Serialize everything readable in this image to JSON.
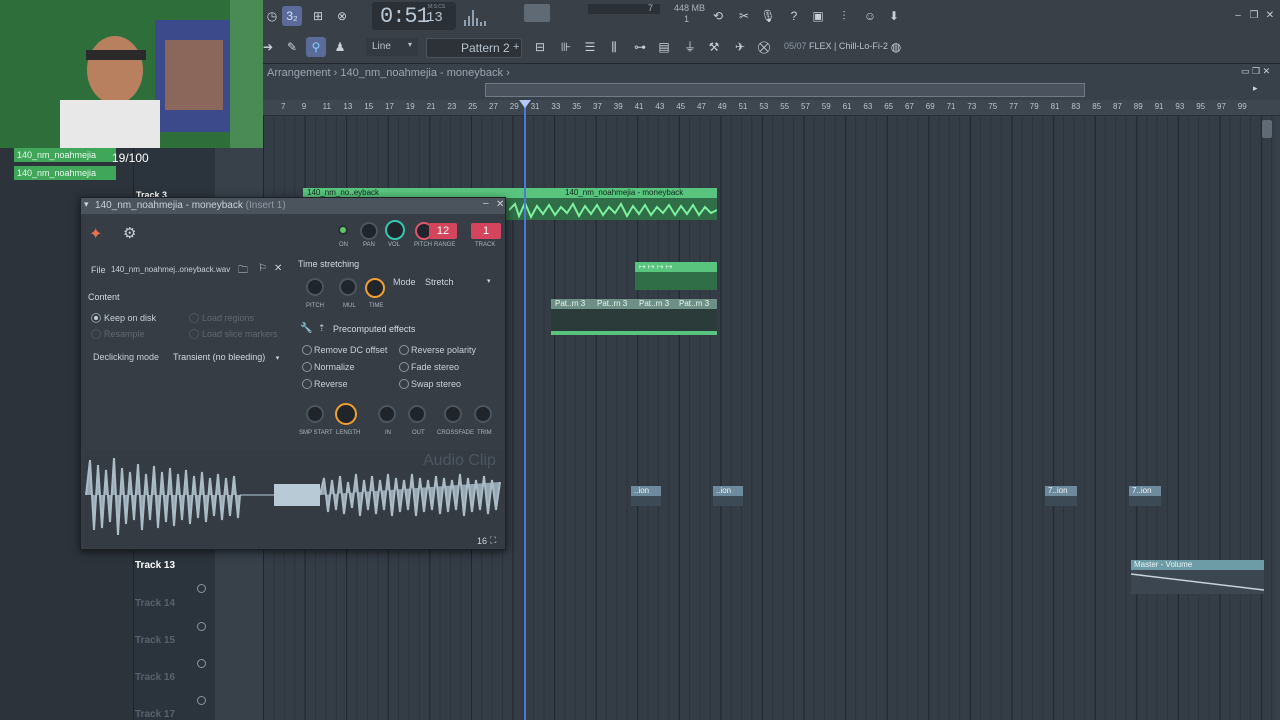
{
  "toolbar": {
    "time_main": "0:51",
    "time_sub": "13",
    "time_unit": "M:S:CS",
    "cpu_value": "7",
    "memory": "448 MB",
    "voices": "1",
    "snap_label": "Line",
    "pattern_label": "Pattern 2",
    "browser_status": "05/07",
    "browser_label": "FLEX | Chill-Lo-Fi-2"
  },
  "playlist": {
    "breadcrumb": "Arrangement › 140_nm_noahmejia - moneyback ›",
    "ruler": [
      "7",
      "9",
      "11",
      "13",
      "15",
      "17",
      "19",
      "21",
      "23",
      "25",
      "27",
      "29",
      "31",
      "33",
      "35",
      "37",
      "39",
      "41",
      "43",
      "45",
      "47",
      "49",
      "51",
      "53",
      "55",
      "57",
      "59",
      "61",
      "63",
      "65",
      "67",
      "69",
      "71",
      "73",
      "75",
      "77",
      "79",
      "81",
      "83",
      "85",
      "87",
      "89",
      "91",
      "93",
      "95",
      "97",
      "99"
    ],
    "audio_clip_label_1": "140_nm_no..eyback",
    "audio_clip_label_2": "140_nm_noahmejia - moneyback",
    "pattern_clip_label": "Pat..rn 3",
    "automation_label_1": "..ion",
    "automation_label_2": "7..ion",
    "master_volume_label": "Master - Volume",
    "track3_label": "Track 3",
    "track13_label": "Track 13",
    "ghost_tracks": [
      "Track 14",
      "Track 15",
      "Track 16",
      "Track 17"
    ]
  },
  "left": {
    "items": [
      "140_nm_noahmejia",
      "140_nm_noahmejia"
    ],
    "counter": "19/100"
  },
  "clip_window": {
    "title": "140_nm_noahmejia - moneyback",
    "title_suffix": "(Insert 1)",
    "knob_labels": [
      "ON",
      "PAN",
      "VOL",
      "PITCH",
      "RANGE",
      "TRACK"
    ],
    "pitch_range_value": "12",
    "track_value": "1",
    "file_label": "File",
    "file_name": "140_nm_noahmej..oneyback.wav",
    "content_label": "Content",
    "keep_on_disk": "Keep on disk",
    "resample": "Resample",
    "load_regions": "Load regions",
    "load_slice_markers": "Load slice markers",
    "declicking_label": "Declicking mode",
    "declicking_value": "Transient (no bleeding)",
    "time_stretching_label": "Time stretching",
    "stretch_knob_labels": [
      "PITCH",
      "MUL",
      "TIME"
    ],
    "mode_label": "Mode",
    "mode_value": "Stretch",
    "precomputed_label": "Precomputed effects",
    "effects": [
      "Remove DC offset",
      "Normalize",
      "Reverse",
      "Reverse polarity",
      "Fade stereo",
      "Swap stereo"
    ],
    "effect_knob_labels": [
      "SMP START",
      "LENGTH",
      "IN",
      "OUT",
      "CROSSFADE",
      "TRIM"
    ],
    "watermark": "Audio Clip",
    "zoom_value": "16"
  },
  "colors": {
    "clip_green": "#58c47e",
    "playhead": "#4d79d6",
    "accent_red": "#d2455c",
    "accent_orange": "#f0a030"
  }
}
